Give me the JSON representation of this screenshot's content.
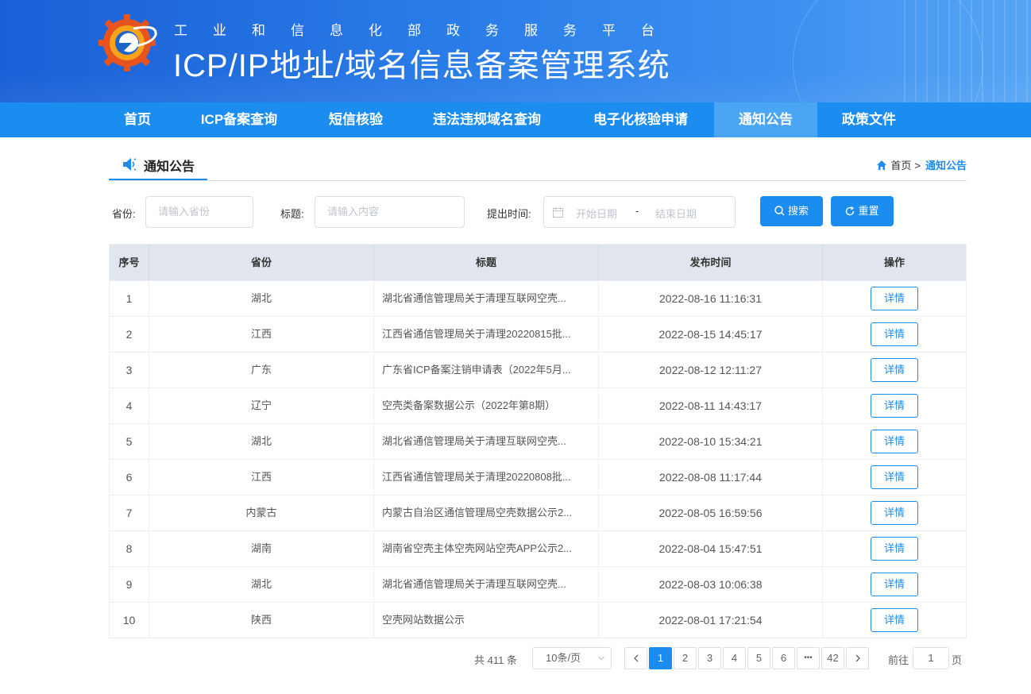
{
  "header": {
    "subtitle": "工业和信息化部政务服务平台",
    "title": "ICP/IP地址/域名信息备案管理系统"
  },
  "nav": {
    "items": [
      {
        "label": "首页"
      },
      {
        "label": "ICP备案查询"
      },
      {
        "label": "短信核验"
      },
      {
        "label": "违法违规域名查询"
      },
      {
        "label": "电子化核验申请"
      },
      {
        "label": "通知公告"
      },
      {
        "label": "政策文件"
      }
    ],
    "active": "通知公告"
  },
  "section": {
    "title": "通知公告",
    "breadcrumb": {
      "home": "首页",
      "separator": ">",
      "current": "通知公告"
    }
  },
  "search": {
    "province_label": "省份:",
    "province_placeholder": "请输入省份",
    "title_label": "标题:",
    "title_placeholder": "请输入内容",
    "time_label": "提出时间:",
    "start_placeholder": "开始日期",
    "range_separator": "-",
    "end_placeholder": "结束日期",
    "search_button": "搜索",
    "reset_button": "重置"
  },
  "table": {
    "columns": [
      "序号",
      "省份",
      "标题",
      "发布时间",
      "操作"
    ],
    "action_label": "详情",
    "rows": [
      {
        "no": "1",
        "province": "湖北",
        "title": "湖北省通信管理局关于清理互联网空壳...",
        "time": "2022-08-16 11:16:31"
      },
      {
        "no": "2",
        "province": "江西",
        "title": "江西省通信管理局关于清理20220815批...",
        "time": "2022-08-15 14:45:17"
      },
      {
        "no": "3",
        "province": "广东",
        "title": "广东省ICP备案注销申请表（2022年5月...",
        "time": "2022-08-12 12:11:27"
      },
      {
        "no": "4",
        "province": "辽宁",
        "title": "空壳类备案数据公示（2022年第8期）",
        "time": "2022-08-11 14:43:17"
      },
      {
        "no": "5",
        "province": "湖北",
        "title": "湖北省通信管理局关于清理互联网空壳...",
        "time": "2022-08-10 15:34:21"
      },
      {
        "no": "6",
        "province": "江西",
        "title": "江西省通信管理局关于清理20220808批...",
        "time": "2022-08-08 11:17:44"
      },
      {
        "no": "7",
        "province": "内蒙古",
        "title": "内蒙古自治区通信管理局空壳数据公示2...",
        "time": "2022-08-05 16:59:56"
      },
      {
        "no": "8",
        "province": "湖南",
        "title": "湖南省空壳主体空壳网站空壳APP公示2...",
        "time": "2022-08-04 15:47:51"
      },
      {
        "no": "9",
        "province": "湖北",
        "title": "湖北省通信管理局关于清理互联网空壳...",
        "time": "2022-08-03 10:06:38"
      },
      {
        "no": "10",
        "province": "陕西",
        "title": "空壳网站数据公示",
        "time": "2022-08-01 17:21:54"
      }
    ]
  },
  "pagination": {
    "total_text": "共 411 条",
    "page_size": "10条/页",
    "pages": [
      "1",
      "2",
      "3",
      "4",
      "5",
      "6",
      "•••",
      "42"
    ],
    "current_page": "1",
    "goto_prefix": "前往",
    "goto_value": "1",
    "goto_suffix": "页"
  },
  "colors": {
    "primary": "#1b8cf0",
    "nav_active": "#4aa6f5",
    "banner": "#2a7de8",
    "table_header": "#e1e6ee"
  },
  "icons": [
    "logo",
    "speaker-icon",
    "home-icon",
    "calendar-icon",
    "search-icon",
    "refresh-icon",
    "chevron-left-icon",
    "chevron-right-icon",
    "chevron-down-icon"
  ]
}
